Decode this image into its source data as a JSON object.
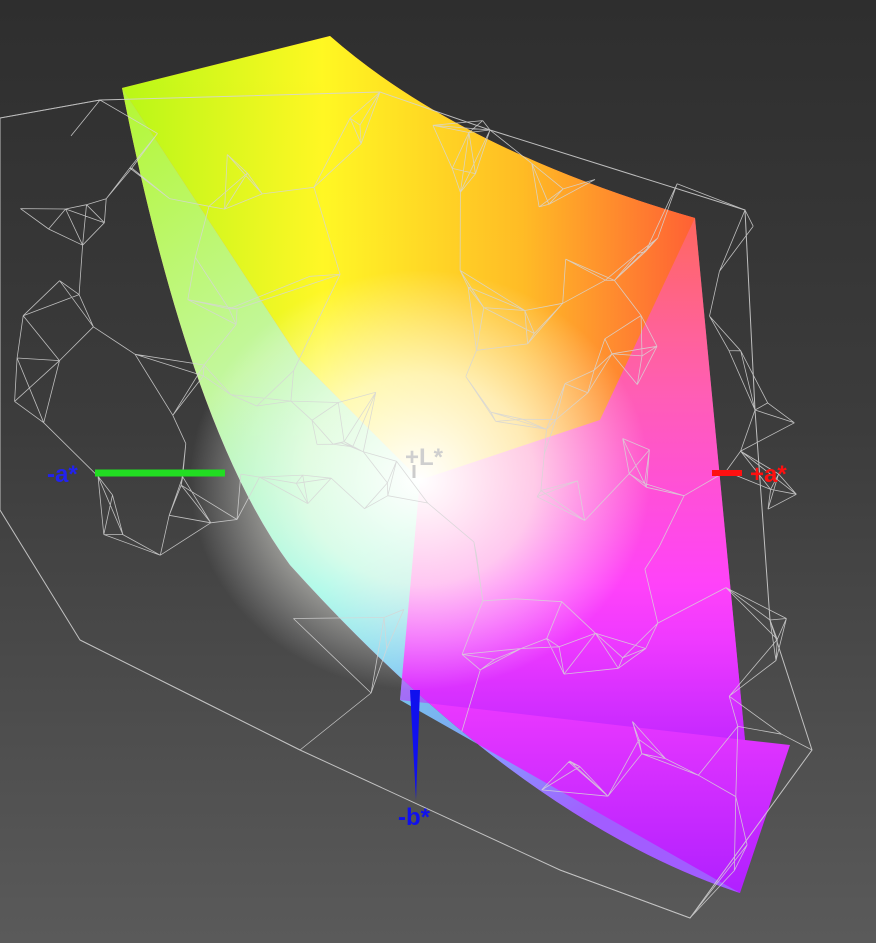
{
  "axes": {
    "plus_L": "+L*",
    "plus_a": "+a*",
    "minus_a": "-a*",
    "minus_b": "-b*"
  },
  "colors": {
    "background_top": "#2e2e2e",
    "background_bottom": "#5a5a5a",
    "wireframe": "#d6d6d6",
    "axis_plus_a": "#ff1010",
    "axis_minus_a": "#22dd22",
    "axis_minus_b": "#1010ee",
    "axis_L": "#c8c8c8"
  },
  "gamut_surface": {
    "corner_colors": [
      "yellow-green",
      "yellow",
      "orange",
      "red-magenta",
      "magenta",
      "purple",
      "blue",
      "cyan"
    ]
  }
}
